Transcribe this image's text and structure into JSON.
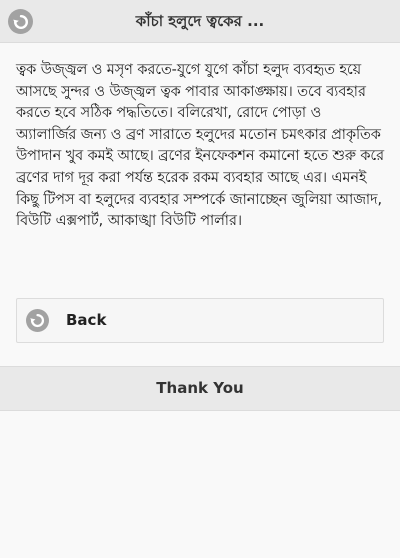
{
  "header": {
    "title": "কাঁচা হলুদে ত্বকের ...",
    "back_icon": "back-arrow-icon"
  },
  "article": {
    "text": "ত্বক উজ্জ্বল ও মসৃণ করতে-যুগে যুগে কাঁচা হলুদ ব্যবহৃত হয়ে আসছে সুন্দর ও উজ্জ্বল ত্বক পাবার আকাঙ্ক্ষায়। তবে ব্যবহার করতে হবে সঠিক পদ্ধতিতে। বলিরেখা, রোদে পোড়া ও অ্যালার্জির জন্য ও ব্রণ সারাতে হলুদের মতোন চমৎকার প্রাকৃতিক উপাদান খুব কমই আছে। ব্রণের ইনফেকশন কমানো হতে শুরু করে ব্রণের দাগ দূর করা পর্যন্ত হরেক রকম ব্যবহার আছে এর। এমনই কিছু টিপস বা হলুদের ব্যবহার সম্পর্কে জানাচ্ছেন জুলিয়া আজাদ, বিউটি এক্সপার্ট, আকাঙ্খা বিউটি পার্লার।"
  },
  "back_button": {
    "label": "Back",
    "icon": "back-arrow-icon"
  },
  "footer": {
    "text": "Thank You"
  },
  "colors": {
    "header_bg": "#e9e9e9",
    "page_bg": "#f9f9f9",
    "icon_circle": "#a2a2a2"
  }
}
